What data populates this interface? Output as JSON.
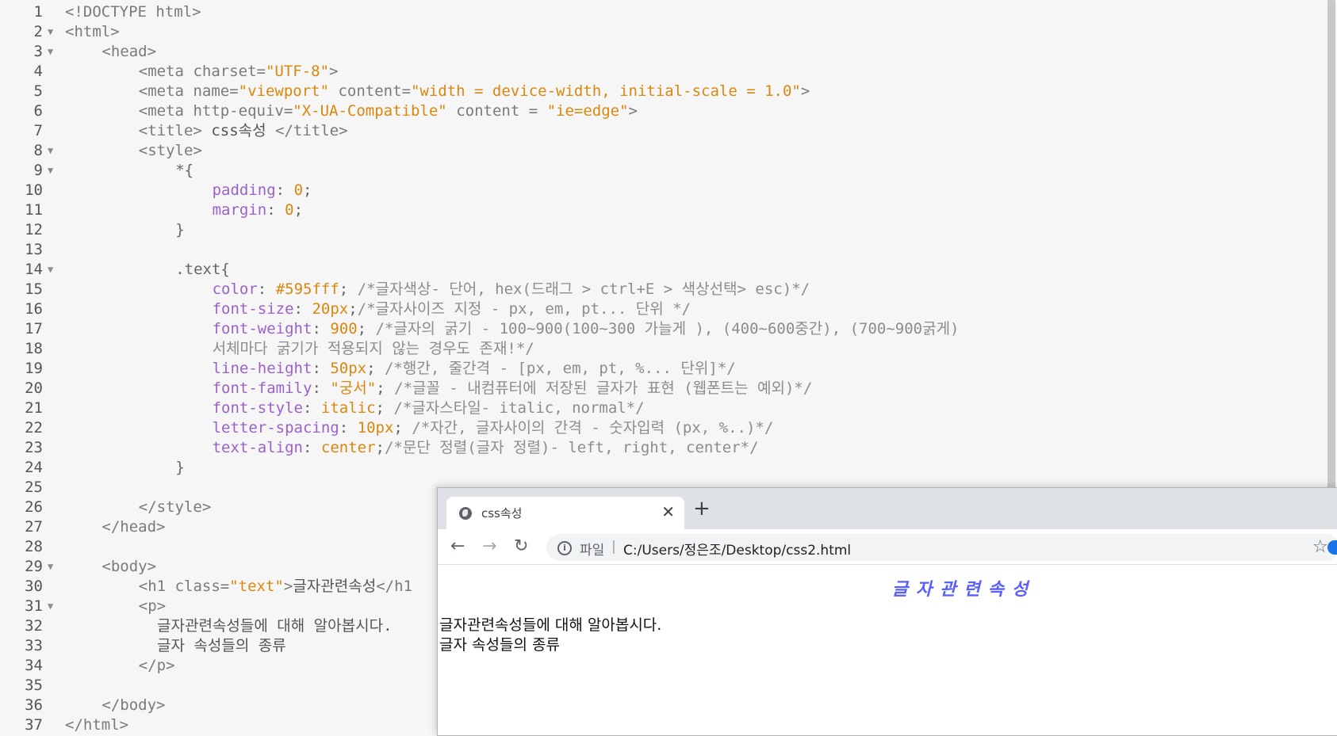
{
  "editor": {
    "lines": [
      {
        "n": "1",
        "fold": false,
        "indent": 0,
        "parts": [
          [
            "tag",
            "<!DOCTYPE html>"
          ]
        ]
      },
      {
        "n": "2",
        "fold": true,
        "indent": 0,
        "parts": [
          [
            "tag",
            "<html>"
          ]
        ]
      },
      {
        "n": "3",
        "fold": true,
        "indent": 4,
        "parts": [
          [
            "tag",
            "<head>"
          ]
        ]
      },
      {
        "n": "4",
        "fold": false,
        "indent": 8,
        "parts": [
          [
            "tag",
            "<meta "
          ],
          [
            "tag",
            "charset="
          ],
          [
            "val",
            "\"UTF-8\""
          ],
          [
            "tag",
            ">"
          ]
        ]
      },
      {
        "n": "5",
        "fold": false,
        "indent": 8,
        "parts": [
          [
            "tag",
            "<meta "
          ],
          [
            "tag",
            "name="
          ],
          [
            "val",
            "\"viewport\""
          ],
          [
            "tag",
            " content="
          ],
          [
            "val",
            "\"width = device-width, initial-scale = 1.0\""
          ],
          [
            "tag",
            ">"
          ]
        ]
      },
      {
        "n": "6",
        "fold": false,
        "indent": 8,
        "parts": [
          [
            "tag",
            "<meta "
          ],
          [
            "tag",
            "http-equiv="
          ],
          [
            "val",
            "\"X-UA-Compatible\""
          ],
          [
            "tag",
            " content = "
          ],
          [
            "val",
            "\"ie=edge\""
          ],
          [
            "tag",
            ">"
          ]
        ]
      },
      {
        "n": "7",
        "fold": false,
        "indent": 8,
        "parts": [
          [
            "tag",
            "<title>"
          ],
          [
            "txt",
            " css속성 "
          ],
          [
            "tag",
            "</title>"
          ]
        ]
      },
      {
        "n": "8",
        "fold": true,
        "indent": 8,
        "parts": [
          [
            "tag",
            "<style>"
          ]
        ]
      },
      {
        "n": "9",
        "fold": true,
        "indent": 12,
        "parts": [
          [
            "punc",
            "*{"
          ]
        ]
      },
      {
        "n": "10",
        "fold": false,
        "indent": 16,
        "parts": [
          [
            "prop",
            "padding"
          ],
          [
            "punc",
            ": "
          ],
          [
            "val",
            "0"
          ],
          [
            "punc",
            ";"
          ]
        ]
      },
      {
        "n": "11",
        "fold": false,
        "indent": 16,
        "parts": [
          [
            "prop",
            "margin"
          ],
          [
            "punc",
            ": "
          ],
          [
            "val",
            "0"
          ],
          [
            "punc",
            ";"
          ]
        ]
      },
      {
        "n": "12",
        "fold": false,
        "indent": 12,
        "parts": [
          [
            "punc",
            "}"
          ]
        ]
      },
      {
        "n": "13",
        "fold": false,
        "indent": 0,
        "parts": []
      },
      {
        "n": "14",
        "fold": true,
        "indent": 12,
        "parts": [
          [
            "punc",
            ".text{"
          ]
        ]
      },
      {
        "n": "15",
        "fold": false,
        "indent": 16,
        "parts": [
          [
            "prop",
            "color"
          ],
          [
            "punc",
            ": "
          ],
          [
            "val",
            "#595fff"
          ],
          [
            "punc",
            "; "
          ],
          [
            "cmt",
            "/*글자색상- 단어, hex(드래그 > ctrl+E > 색상선택> esc)*/"
          ]
        ]
      },
      {
        "n": "16",
        "fold": false,
        "indent": 16,
        "parts": [
          [
            "prop",
            "font-size"
          ],
          [
            "punc",
            ": "
          ],
          [
            "val",
            "20px"
          ],
          [
            "punc",
            ";"
          ],
          [
            "cmt",
            "/*글자사이즈 지정 - px, em, pt... 단위 */"
          ]
        ]
      },
      {
        "n": "17",
        "fold": false,
        "indent": 16,
        "parts": [
          [
            "prop",
            "font-weight"
          ],
          [
            "punc",
            ": "
          ],
          [
            "val",
            "900"
          ],
          [
            "punc",
            "; "
          ],
          [
            "cmt",
            "/*글자의 굵기 - 100~900(100~300 가늘게 ), (400~600중간), (700~900굵게)"
          ]
        ]
      },
      {
        "n": "18",
        "fold": false,
        "indent": 16,
        "parts": [
          [
            "cmt",
            "서체마다 굵기가 적용되지 않는 경우도 존재!*/"
          ]
        ]
      },
      {
        "n": "19",
        "fold": false,
        "indent": 16,
        "parts": [
          [
            "prop",
            "line-height"
          ],
          [
            "punc",
            ": "
          ],
          [
            "val",
            "50px"
          ],
          [
            "punc",
            "; "
          ],
          [
            "cmt",
            "/*행간, 줄간격 - [px, em, pt, %... 단위]*/"
          ]
        ]
      },
      {
        "n": "20",
        "fold": false,
        "indent": 16,
        "parts": [
          [
            "prop",
            "font-family"
          ],
          [
            "punc",
            ": "
          ],
          [
            "val",
            "\"궁서\""
          ],
          [
            "punc",
            "; "
          ],
          [
            "cmt",
            "/*글꼴 - 내컴퓨터에 저장된 글자가 표현 (웹폰트는 예외)*/"
          ]
        ]
      },
      {
        "n": "21",
        "fold": false,
        "indent": 16,
        "parts": [
          [
            "prop",
            "font-style"
          ],
          [
            "punc",
            ": "
          ],
          [
            "val",
            "italic"
          ],
          [
            "punc",
            "; "
          ],
          [
            "cmt",
            "/*글자스타일- italic, normal*/"
          ]
        ]
      },
      {
        "n": "22",
        "fold": false,
        "indent": 16,
        "parts": [
          [
            "prop",
            "letter-spacing"
          ],
          [
            "punc",
            ": "
          ],
          [
            "val",
            "10px"
          ],
          [
            "punc",
            "; "
          ],
          [
            "cmt",
            "/*자간, 글자사이의 간격 - 숫자입력 (px, %..)*/"
          ]
        ]
      },
      {
        "n": "23",
        "fold": false,
        "indent": 16,
        "parts": [
          [
            "prop",
            "text-align"
          ],
          [
            "punc",
            ": "
          ],
          [
            "val",
            "center"
          ],
          [
            "punc",
            ";"
          ],
          [
            "cmt",
            "/*문단 정렬(글자 정렬)- left, right, center*/"
          ]
        ]
      },
      {
        "n": "24",
        "fold": false,
        "indent": 12,
        "parts": [
          [
            "punc",
            "}"
          ]
        ]
      },
      {
        "n": "25",
        "fold": false,
        "indent": 0,
        "parts": []
      },
      {
        "n": "26",
        "fold": false,
        "indent": 8,
        "parts": [
          [
            "tag",
            "</style>"
          ]
        ]
      },
      {
        "n": "27",
        "fold": false,
        "indent": 4,
        "parts": [
          [
            "tag",
            "</head>"
          ]
        ]
      },
      {
        "n": "28",
        "fold": false,
        "indent": 0,
        "parts": []
      },
      {
        "n": "29",
        "fold": true,
        "indent": 4,
        "parts": [
          [
            "tag",
            "<body>"
          ]
        ]
      },
      {
        "n": "30",
        "fold": false,
        "indent": 8,
        "parts": [
          [
            "tag",
            "<h1 "
          ],
          [
            "tag",
            "class="
          ],
          [
            "val",
            "\"text\""
          ],
          [
            "tag",
            ">"
          ],
          [
            "txt",
            "글자관련속성"
          ],
          [
            "tag",
            "</h1"
          ]
        ]
      },
      {
        "n": "31",
        "fold": true,
        "indent": 8,
        "parts": [
          [
            "tag",
            "<p>"
          ]
        ]
      },
      {
        "n": "32",
        "fold": false,
        "indent": 10,
        "parts": [
          [
            "txt",
            "글자관련속성들에 대해 알아봅시다."
          ]
        ]
      },
      {
        "n": "33",
        "fold": false,
        "indent": 10,
        "parts": [
          [
            "txt",
            "글자 속성들의 종류"
          ]
        ]
      },
      {
        "n": "34",
        "fold": false,
        "indent": 8,
        "parts": [
          [
            "tag",
            "</p>"
          ]
        ]
      },
      {
        "n": "35",
        "fold": false,
        "indent": 0,
        "parts": []
      },
      {
        "n": "36",
        "fold": false,
        "indent": 4,
        "parts": [
          [
            "tag",
            "</body>"
          ]
        ]
      },
      {
        "n": "37",
        "fold": false,
        "indent": 0,
        "parts": [
          [
            "tag",
            "</html>"
          ]
        ]
      }
    ]
  },
  "browser": {
    "tab_title": "css속성",
    "tab_close": "✕",
    "new_tab": "+",
    "nav_back": "←",
    "nav_forward": "→",
    "nav_reload": "↻",
    "address_scheme": "파일",
    "address_separator": "|",
    "address_url": "C:/Users/정은조/Desktop/css2.html",
    "bookmark_star": "☆",
    "info_icon": "i",
    "page": {
      "heading": "글자관련속성",
      "paragraph_line1": "글자관련속성들에 대해 알아봅시다.",
      "paragraph_line2": "글자 속성들의 종류"
    }
  },
  "colors": {
    "editor_bg": "#f6f6f6",
    "heading_color": "#595fff",
    "value_color": "#d9880f",
    "property_color": "#9a62c8"
  },
  "icons": {
    "tab_favicon": "globe-icon",
    "omnibox_info": "info-icon",
    "bookmark": "star-icon",
    "extension": "extension-icon"
  }
}
